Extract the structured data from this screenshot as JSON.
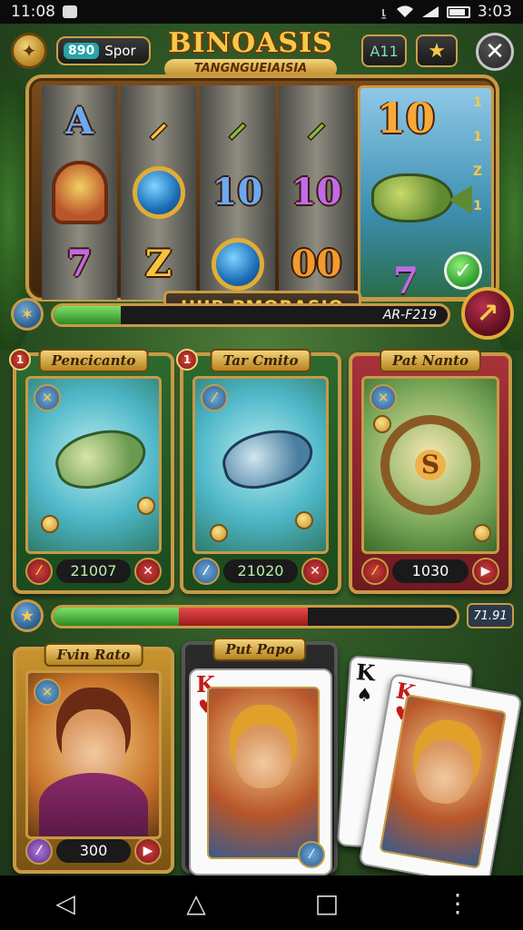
{
  "status_bar": {
    "time": "11:08",
    "battery": "3:03"
  },
  "hud": {
    "coins_value": "890",
    "coins_label": "Spor",
    "title": "BINOASIS",
    "subtitle": "TANGNGUEIAISIA",
    "level": "A11",
    "star": "★",
    "close": "✕"
  },
  "slot": {
    "reels": [
      [
        "A",
        "",
        "7"
      ],
      [
        "",
        "",
        "Z"
      ],
      [
        "10",
        "",
        ""
      ],
      [
        "10",
        "00",
        ""
      ]
    ],
    "feature_value": "10",
    "feature_side": [
      "1",
      "1",
      "Z",
      "1"
    ],
    "banner": "HUB PMORASIO"
  },
  "progress_bar_1": {
    "label": "AR-F219",
    "fill": 0.17
  },
  "progress_bar_2": {
    "label": "71.91",
    "green_fill": 0.31,
    "red_fill": 0.32
  },
  "cards_row_1": [
    {
      "badge": "1",
      "title": "Pencicanto",
      "value": "21007"
    },
    {
      "badge": "1",
      "title": "Tar Cmito",
      "value": "21020"
    },
    {
      "badge": "",
      "title": "Pat Nanto",
      "value": "1030"
    }
  ],
  "cards_row_2": [
    {
      "badge": "",
      "title": "Fvin Rato",
      "value": "300"
    },
    {
      "badge": "",
      "title": "Put Papo",
      "value": ""
    }
  ],
  "playing_cards": [
    {
      "rank": "K",
      "suit": "♥"
    },
    {
      "rank": "K",
      "suit": "♠"
    },
    {
      "rank": "K",
      "suit": "♥"
    }
  ],
  "nav": {
    "back": "◁",
    "home": "△",
    "recents": "□",
    "more": "⋮"
  }
}
